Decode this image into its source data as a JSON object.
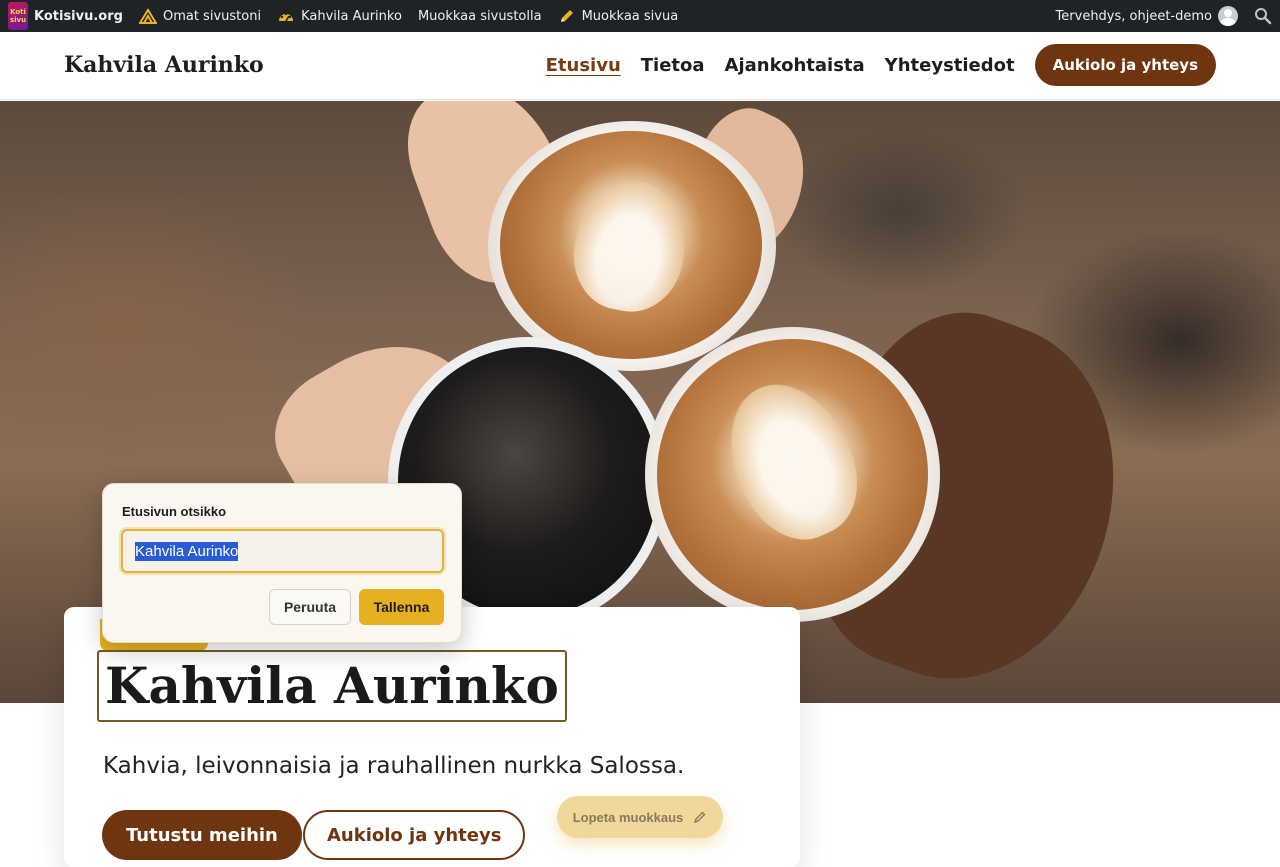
{
  "admin_bar": {
    "logo_text": "Koti sivu",
    "brand": "Kotisivu.org",
    "my_sites": "Omat sivustoni",
    "site_name": "Kahvila Aurinko",
    "customize": "Muokkaa sivustolla",
    "edit_page": "Muokkaa sivua",
    "greeting": "Tervehdys, ohjeet-demo"
  },
  "header": {
    "site_title": "Kahvila Aurinko",
    "nav": [
      "Etusivu",
      "Tietoa",
      "Ajankohtaista",
      "Yhteystiedot"
    ],
    "cta": "Aukiolo ja yhteys"
  },
  "hero": {
    "title": "Kahvila Aurinko",
    "subtitle": "Kahvia, leivonnaisia ja rauhallinen nurkka Salossa.",
    "primary_button": "Tutustu meihin",
    "secondary_button": "Aukiolo ja yhteys"
  },
  "popover": {
    "label": "Etusivun otsikko",
    "input_value": "Kahvila Aurinko",
    "cancel": "Peruuta",
    "save": "Tallenna"
  },
  "stop_editing": "Lopeta muokkaus",
  "colors": {
    "brand_brown": "#6f3510",
    "accent_gold": "#e6b020",
    "admin_bar_bg": "#1d2327"
  },
  "icons": [
    "sites-icon",
    "dashboard-icon",
    "pencil-icon",
    "avatar-icon",
    "search-icon"
  ]
}
